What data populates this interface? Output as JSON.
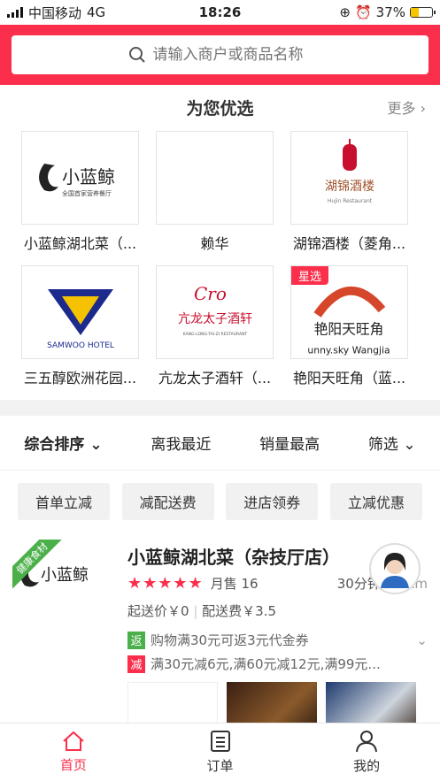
{
  "status": {
    "carrier": "中国移动",
    "network": "4G",
    "time": "18:26",
    "battery": "37%",
    "battery_level": 0.37
  },
  "search": {
    "placeholder": "请输入商户或商品名称"
  },
  "picks": {
    "title": "为您优选",
    "more": "更多",
    "items": [
      {
        "name": "小蓝鲸湖北菜（...",
        "logo_text": "小蓝鲸",
        "logo_sub": "全国首家营养餐厅",
        "tag": ""
      },
      {
        "name": "赖华",
        "logo_text": "",
        "logo_sub": "",
        "tag": ""
      },
      {
        "name": "湖锦酒楼（菱角...",
        "logo_text": "湖锦酒楼",
        "logo_sub": "Hujin Restaurant",
        "tag": ""
      },
      {
        "name": "三五醇欧洲花园...",
        "logo_text": "SAMWOO HOTEL",
        "logo_sub": "",
        "tag": ""
      },
      {
        "name": "亢龙太子酒轩（...",
        "logo_text": "亢龙太子酒轩",
        "logo_sub": "KANG-LONG-TAI-ZI RESTAURANT",
        "tag": ""
      },
      {
        "name": "艳阳天旺角（蓝...",
        "logo_text": "艳阳天旺角",
        "logo_sub": "unny.sky Wangjia",
        "tag": "星选"
      }
    ]
  },
  "sort": {
    "items": [
      "综合排序",
      "离我最近",
      "销量最高",
      "筛选"
    ]
  },
  "chips": [
    "首单立减",
    "减配送费",
    "进店领券",
    "立减优惠"
  ],
  "shop": {
    "name": "小蓝鲸湖北菜（杂技厅店）",
    "ribbon": "健康食材",
    "rating_stars": 5,
    "monthly_sales": "月售 16",
    "time": "30分钟",
    "distance": "81 km",
    "min_order": "起送价￥0",
    "delivery_fee": "配送费￥3.5",
    "promo1_badge": "返",
    "promo1": "购物满30元可返3元代金券",
    "promo2_badge": "减",
    "promo2": "满30元减6元,满60元减12元,满99元..."
  },
  "tabs": [
    {
      "label": "首页"
    },
    {
      "label": "订单"
    },
    {
      "label": "我的"
    }
  ],
  "colors": {
    "accent": "#fb2f4b",
    "green": "#4cb04a"
  }
}
